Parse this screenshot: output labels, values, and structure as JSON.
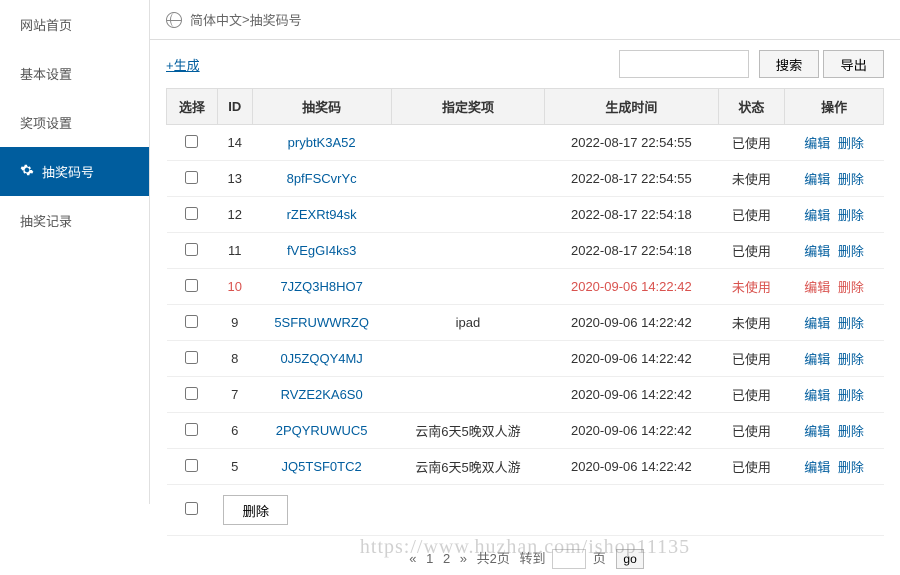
{
  "sidebar": {
    "items": [
      {
        "label": "网站首页"
      },
      {
        "label": "基本设置"
      },
      {
        "label": "奖项设置"
      },
      {
        "label": "抽奖码号"
      },
      {
        "label": "抽奖记录"
      }
    ]
  },
  "breadcrumb": {
    "lang": "简体中文",
    "sep": " > ",
    "page": "抽奖码号"
  },
  "toolbar": {
    "generate": "+生成",
    "search_btn": "搜索",
    "export_btn": "导出"
  },
  "table": {
    "headers": [
      "选择",
      "ID",
      "抽奖码",
      "指定奖项",
      "生成时间",
      "状态",
      "操作"
    ],
    "rows": [
      {
        "id": "14",
        "code": "prybtK3A52",
        "prize": "",
        "time": "2022-08-17 22:54:55",
        "status": "已使用",
        "red": false
      },
      {
        "id": "13",
        "code": "8pfFSCvrYc",
        "prize": "",
        "time": "2022-08-17 22:54:55",
        "status": "未使用",
        "red": false
      },
      {
        "id": "12",
        "code": "rZEXRt94sk",
        "prize": "",
        "time": "2022-08-17 22:54:18",
        "status": "已使用",
        "red": false
      },
      {
        "id": "11",
        "code": "fVEgGI4ks3",
        "prize": "",
        "time": "2022-08-17 22:54:18",
        "status": "已使用",
        "red": false
      },
      {
        "id": "10",
        "code": "7JZQ3H8HO7",
        "prize": "",
        "time": "2020-09-06 14:22:42",
        "status": "未使用",
        "red": true
      },
      {
        "id": "9",
        "code": "5SFRUWWRZQ",
        "prize": "ipad",
        "time": "2020-09-06 14:22:42",
        "status": "未使用",
        "red": false
      },
      {
        "id": "8",
        "code": "0J5ZQQY4MJ",
        "prize": "",
        "time": "2020-09-06 14:22:42",
        "status": "已使用",
        "red": false
      },
      {
        "id": "7",
        "code": "RVZE2KA6S0",
        "prize": "",
        "time": "2020-09-06 14:22:42",
        "status": "已使用",
        "red": false
      },
      {
        "id": "6",
        "code": "2PQYRUWUC5",
        "prize": "云南6天5晚双人游",
        "time": "2020-09-06 14:22:42",
        "status": "已使用",
        "red": false
      },
      {
        "id": "5",
        "code": "JQ5TSF0TC2",
        "prize": "云南6天5晚双人游",
        "time": "2020-09-06 14:22:42",
        "status": "已使用",
        "red": false
      }
    ],
    "actions": {
      "edit": "编辑",
      "delete": "删除"
    },
    "bulk_delete": "删除"
  },
  "pager": {
    "first": "«",
    "page1": "1",
    "page2": "2",
    "last": "»",
    "total": "共2页",
    "jump_prefix": "转到",
    "jump_suffix": "页",
    "go": "go"
  },
  "watermark": "https://www.huzhan.com/ishop11135"
}
